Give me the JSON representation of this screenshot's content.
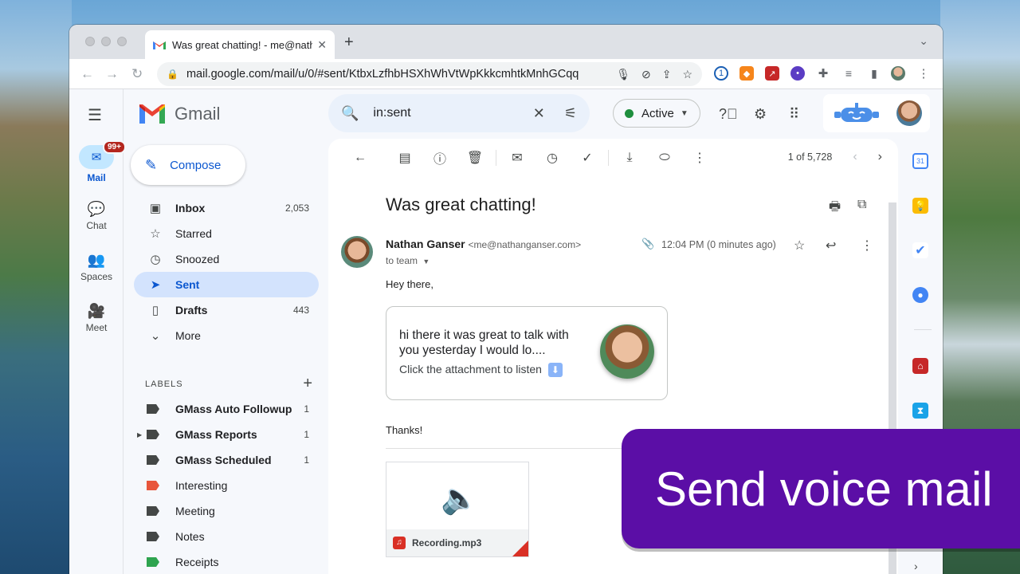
{
  "browser": {
    "tab_title": "Was great chatting! - me@nathanganser.com",
    "url": "mail.google.com/mail/u/0/#sent/KtbxLzfhbHSXhWhVtWpKkkcmhtkMnhGCqq"
  },
  "gmail": {
    "brand": "Gmail",
    "compose_label": "Compose",
    "rail": {
      "mail": "Mail",
      "mail_badge": "99+",
      "chat": "Chat",
      "spaces": "Spaces",
      "meet": "Meet"
    },
    "search_value": "in:sent",
    "status_label": "Active",
    "folders": [
      {
        "name": "Inbox",
        "count": "2,053",
        "bold": true
      },
      {
        "name": "Starred",
        "count": ""
      },
      {
        "name": "Snoozed",
        "count": ""
      },
      {
        "name": "Sent",
        "count": "",
        "active": true
      },
      {
        "name": "Drafts",
        "count": "443",
        "bold": true
      },
      {
        "name": "More",
        "count": ""
      }
    ],
    "labels_heading": "LABELS",
    "labels": [
      {
        "name": "GMass Auto Followup",
        "count": "1",
        "color": "#444746"
      },
      {
        "name": "GMass Reports",
        "count": "1",
        "color": "#444746"
      },
      {
        "name": "GMass Scheduled",
        "count": "1",
        "color": "#444746"
      },
      {
        "name": "Interesting",
        "count": "",
        "color": "#e8553b"
      },
      {
        "name": "Meeting",
        "count": "",
        "color": "#444746"
      },
      {
        "name": "Notes",
        "count": "",
        "color": "#444746"
      },
      {
        "name": "Receipts",
        "count": "",
        "color": "#2ea44f"
      }
    ]
  },
  "message": {
    "pager": "1 of 5,728",
    "subject": "Was great chatting!",
    "sender_name": "Nathan Ganser",
    "sender_email": "<me@nathanganser.com>",
    "to": "to team",
    "time": "12:04 PM (0 minutes ago)",
    "greeting": "Hey there,",
    "card_text": "hi there it was great to talk with you yesterday I would lo....",
    "card_cta": "Click the attachment to listen",
    "thanks": "Thanks!",
    "attachment_name": "Recording.mp3"
  },
  "promo_text": "Send voice mail"
}
